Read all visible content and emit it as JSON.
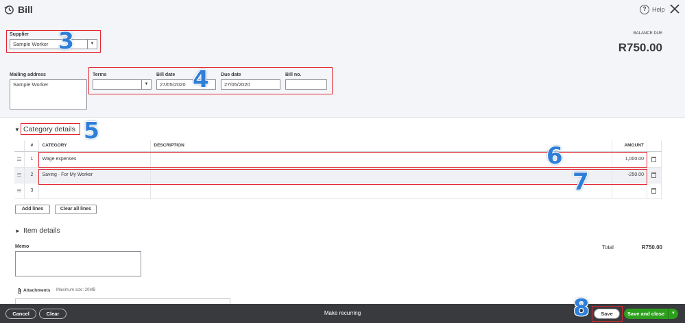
{
  "header": {
    "title": "Bill",
    "help_label": "Help",
    "help_glyph": "?"
  },
  "supplier": {
    "label": "Supplier",
    "value": "Sample Worker"
  },
  "balance": {
    "label": "BALANCE DUE",
    "amount": "R750.00"
  },
  "mailing": {
    "label": "Mailing address",
    "value": "Sample Worker"
  },
  "terms": {
    "label": "Terms",
    "value": ""
  },
  "bill_date": {
    "label": "Bill date",
    "value": "27/05/2020"
  },
  "due_date": {
    "label": "Due date",
    "value": "27/05/2020"
  },
  "bill_no": {
    "label": "Bill no.",
    "value": ""
  },
  "category_section": {
    "title": "Category details",
    "columns": {
      "num": "#",
      "category": "CATEGORY",
      "description": "DESCRIPTION",
      "amount": "AMOUNT"
    },
    "rows": [
      {
        "num": "1",
        "category": "Wage expenses",
        "description": "",
        "amount": "1,000.00"
      },
      {
        "num": "2",
        "category": "Saving · For My Worker",
        "description": "",
        "amount": "-250.00"
      },
      {
        "num": "3",
        "category": "",
        "description": "",
        "amount": ""
      }
    ],
    "add_lines": "Add lines",
    "clear_lines": "Clear all lines"
  },
  "item_section": {
    "title": "Item details"
  },
  "memo": {
    "label": "Memo",
    "value": ""
  },
  "attachments": {
    "label": "Attachments",
    "hint": "Maximum size: 20MB"
  },
  "total": {
    "label": "Total",
    "value": "R750.00"
  },
  "footer": {
    "cancel": "Cancel",
    "clear": "Clear",
    "make_recurring": "Make recurring",
    "save": "Save",
    "save_and_close": "Save and close"
  },
  "annotations": [
    "3",
    "4",
    "5",
    "6",
    "7",
    "8"
  ],
  "colors": {
    "highlight": "#e2252f",
    "step_number": "#2f7fd8",
    "primary_green": "#2ca01c",
    "footer_bg": "#393a3d"
  },
  "icons": [
    "history-icon",
    "help-icon",
    "close-icon",
    "dropdown-arrow-icon",
    "caret-down-icon",
    "caret-right-icon",
    "drag-handle-icon",
    "trash-icon",
    "paperclip-icon"
  ]
}
